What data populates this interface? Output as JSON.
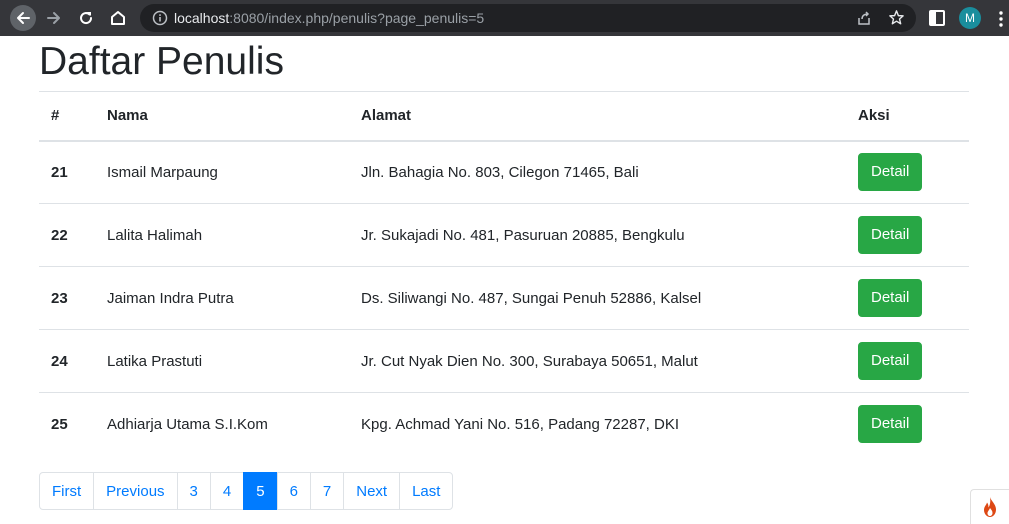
{
  "browser": {
    "url_host": "localhost",
    "url_path": ":8080/index.php/penulis?page_penulis=5",
    "avatar_letter": "M",
    "colors": {
      "toolbar": "#35363a",
      "omnibox": "#202124",
      "avatar": "#1a8e9d"
    }
  },
  "page": {
    "title": "Daftar Penulis",
    "table": {
      "headers": {
        "num": "#",
        "nama": "Nama",
        "alamat": "Alamat",
        "aksi": "Aksi"
      },
      "rows": [
        {
          "num": "21",
          "nama": "Ismail Marpaung",
          "alamat": "Jln. Bahagia No. 803, Cilegon 71465, Bali",
          "action": "Detail"
        },
        {
          "num": "22",
          "nama": "Lalita Halimah",
          "alamat": "Jr. Sukajadi No. 481, Pasuruan 20885, Bengkulu",
          "action": "Detail"
        },
        {
          "num": "23",
          "nama": "Jaiman Indra Putra",
          "alamat": "Ds. Siliwangi No. 487, Sungai Penuh 52886, Kalsel",
          "action": "Detail"
        },
        {
          "num": "24",
          "nama": "Latika Prastuti",
          "alamat": "Jr. Cut Nyak Dien No. 300, Surabaya 50651, Malut",
          "action": "Detail"
        },
        {
          "num": "25",
          "nama": "Adhiarja Utama S.I.Kom",
          "alamat": "Kpg. Achmad Yani No. 516, Padang 72287, DKI",
          "action": "Detail"
        }
      ]
    },
    "pagination": {
      "first": "First",
      "previous": "Previous",
      "pages": [
        "3",
        "4",
        "5",
        "6",
        "7"
      ],
      "active_page": "5",
      "next": "Next",
      "last": "Last"
    },
    "colors": {
      "success": "#28a745",
      "primary": "#007bff",
      "text": "#212529",
      "border": "#dee2e6"
    }
  }
}
